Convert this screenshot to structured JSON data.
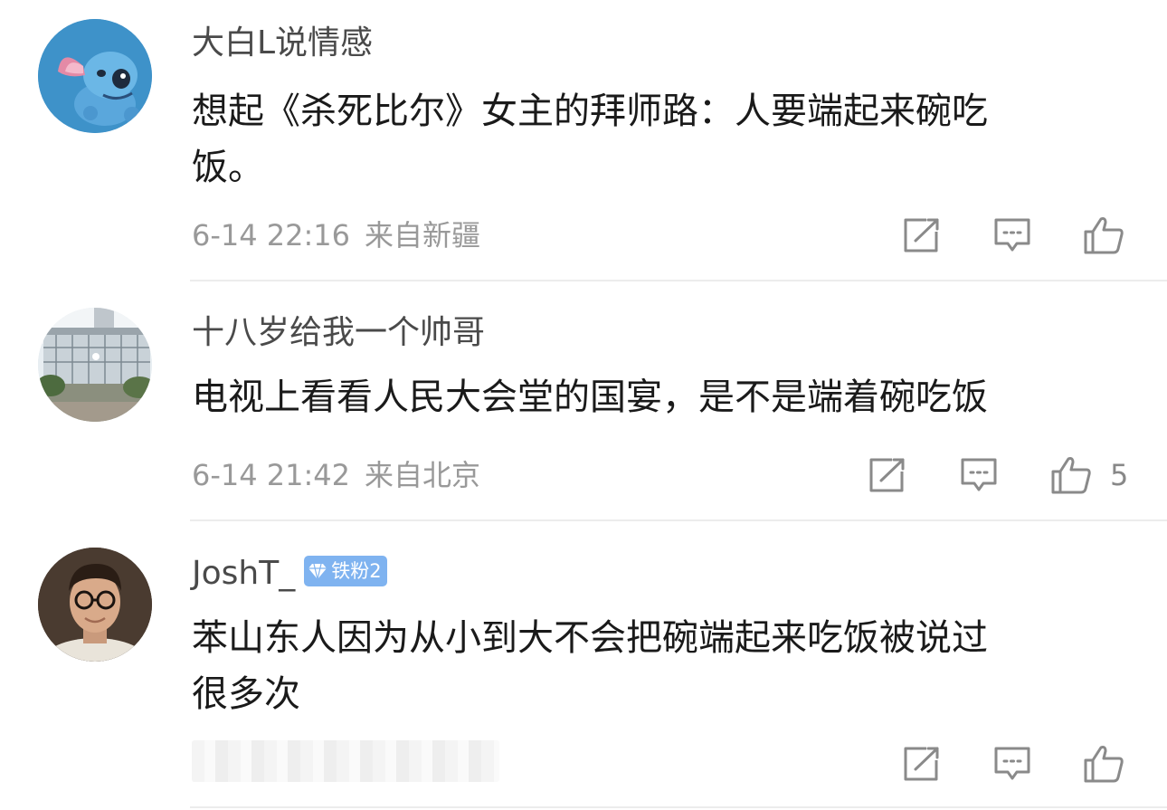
{
  "comments": [
    {
      "username": "大白L说情感",
      "content": "想起《杀死比尔》女主的拜师路：人要端起来碗吃\n饭。",
      "time": "6-14 22:16",
      "location": "来自新疆",
      "likes": "",
      "avatar_icon": "stitch-cartoon-avatar"
    },
    {
      "username": "十八岁给我一个帅哥",
      "content": "电视上看看人民大会堂的国宴，是不是端着碗吃饭",
      "time": "6-14 21:42",
      "location": "来自北京",
      "likes": "5",
      "avatar_icon": "building-photo-avatar"
    },
    {
      "username": "JoshT_",
      "badge": "铁粉2",
      "content": "苯山东人因为从小到大不会把碗端起来吃饭被说过\n很多次",
      "time": "",
      "location": "",
      "likes": "",
      "avatar_icon": "man-with-glasses-avatar"
    }
  ],
  "actions": {
    "repost_icon": "repost-icon",
    "comment_icon": "comment-icon",
    "like_icon": "like-icon"
  },
  "colors": {
    "badge": "#7fb3f0",
    "meta_text": "#999999",
    "divider": "#ececec"
  }
}
